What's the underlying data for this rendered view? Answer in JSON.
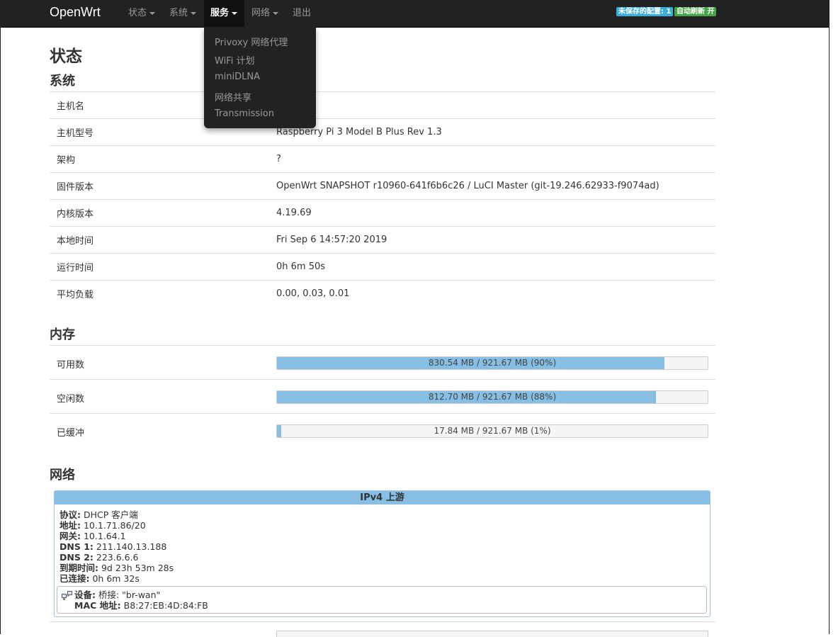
{
  "navbar": {
    "brand": "OpenWrt",
    "menus": [
      {
        "label": "状态"
      },
      {
        "label": "系统"
      },
      {
        "label": "服务"
      },
      {
        "label": "网络"
      },
      {
        "label": "退出"
      }
    ],
    "badges": {
      "unsaved": "未保存的配置: 1",
      "autorefresh": "自动刷新 开"
    },
    "colors": {
      "unsaved": "#3aaed8",
      "autorefresh": "#46a546"
    }
  },
  "dropdown": {
    "items": [
      "Privoxy 网络代理",
      "WiFi 计划",
      "miniDLNA",
      "网络共享",
      "Transmission"
    ]
  },
  "page": {
    "title": "状态"
  },
  "system": {
    "title": "系统",
    "rows": [
      {
        "key": "主机名",
        "value": ""
      },
      {
        "key": "主机型号",
        "value": "Raspberry Pi 3 Model B Plus Rev 1.3"
      },
      {
        "key": "架构",
        "value": "?"
      },
      {
        "key": "固件版本",
        "value": "OpenWrt SNAPSHOT r10960-641f6b6c26 / LuCI Master (git-19.246.62933-f9074ad)"
      },
      {
        "key": "内核版本",
        "value": "4.19.69"
      },
      {
        "key": "本地时间",
        "value": "Fri Sep 6 14:57:20 2019"
      },
      {
        "key": "运行时间",
        "value": "0h 6m 50s"
      },
      {
        "key": "平均负载",
        "value": "0.00, 0.03, 0.01"
      }
    ]
  },
  "memory": {
    "title": "内存",
    "rows": [
      {
        "label": "可用数",
        "text": "830.54 MB / 921.67 MB (90%)",
        "percent": 90
      },
      {
        "label": "空闲数",
        "text": "812.70 MB / 921.67 MB (88%)",
        "percent": 88
      },
      {
        "label": "已缓冲",
        "text": "17.84 MB / 921.67 MB (1%)",
        "percent": 1
      }
    ],
    "bar_color": "#86bfe3"
  },
  "network": {
    "title": "网络",
    "ipv4": {
      "header": "IPv4 上游",
      "fields": [
        {
          "k": "协议:",
          "v": "DHCP 客户端"
        },
        {
          "k": "地址:",
          "v": "10.1.71.86/20"
        },
        {
          "k": "网关:",
          "v": "10.1.64.1"
        },
        {
          "k": "DNS 1:",
          "v": "211.140.13.188"
        },
        {
          "k": "DNS 2:",
          "v": "223.6.6.6"
        },
        {
          "k": "到期时间:",
          "v": "9d 23h 53m 28s"
        },
        {
          "k": "已连接:",
          "v": "0h 6m 32s"
        }
      ],
      "device": {
        "k1": "设备:",
        "v1": "桥接: \"br-wan\"",
        "k2": "MAC 地址:",
        "v2": "B8:27:EB:4D:84:FB",
        "icon": "bridge-icon"
      }
    }
  }
}
